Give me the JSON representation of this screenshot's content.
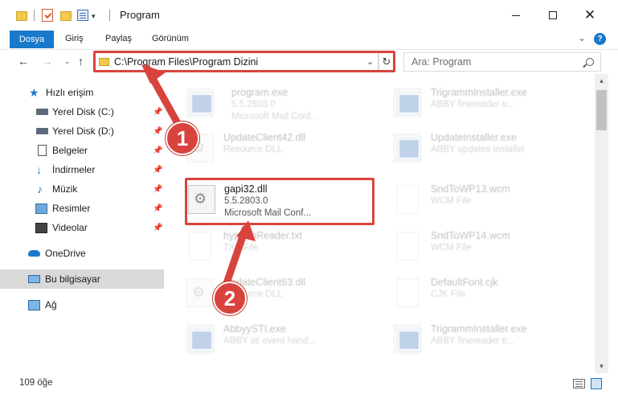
{
  "window": {
    "title": "Program",
    "dropdown_glyph": "▾",
    "minimize_icon": "minimize-icon",
    "maximize_icon": "maximize-icon",
    "close_glyph": "✕"
  },
  "ribbon": {
    "tabs": [
      "Dosya",
      "Giriş",
      "Paylaş",
      "Görünüm"
    ],
    "collapse_glyph": "⌄",
    "help_glyph": "?"
  },
  "nav": {
    "back_glyph": "←",
    "forward_glyph": "→",
    "recent_glyph": "⌄",
    "up_glyph": "↑",
    "address": "C:\\Program Files\\Program Dizini",
    "address_dropdown": "⌄",
    "refresh_glyph": "↻",
    "search_placeholder": "Ara: Program"
  },
  "sidebar": {
    "items": [
      {
        "label": "Hızlı erişim",
        "icon": "star-icon",
        "glyph": "★",
        "pinned": false
      },
      {
        "label": "Yerel Disk (C:)",
        "icon": "disk-icon",
        "pinned": true
      },
      {
        "label": "Yerel Disk (D:)",
        "icon": "disk-icon",
        "pinned": true
      },
      {
        "label": "Belgeler",
        "icon": "documents-icon",
        "pinned": true
      },
      {
        "label": "İndirmeler",
        "icon": "download-icon",
        "glyph": "↓",
        "pinned": true
      },
      {
        "label": "Müzik",
        "icon": "music-icon",
        "glyph": "♪",
        "pinned": true
      },
      {
        "label": "Resimler",
        "icon": "pictures-icon",
        "pinned": true
      },
      {
        "label": "Videolar",
        "icon": "video-icon",
        "pinned": true
      },
      {
        "label": "OneDrive",
        "icon": "cloud-icon",
        "pinned": false
      },
      {
        "label": "Bu bilgisayar",
        "icon": "computer-icon",
        "pinned": false,
        "selected": true
      },
      {
        "label": "Ağ",
        "icon": "network-icon",
        "pinned": false
      }
    ],
    "pin_glyph": "📌"
  },
  "files": [
    {
      "name": "program.exe",
      "line2": "5.5.2803.0",
      "line3": "Microsoft Mail Conf...",
      "icon": "exe-icon",
      "faded": true
    },
    {
      "name": "TrigrammInstaller.exe",
      "line2": "ABBY finereader tr...",
      "line3": "",
      "icon": "exe-icon",
      "faded": true
    },
    {
      "name": "UpdateClient42.dll",
      "line2": "Resource DLL",
      "line3": "",
      "icon": "dll-icon",
      "faded": true
    },
    {
      "name": "UpdateInstaller.exe",
      "line2": "ABBY updates installer",
      "line3": "",
      "icon": "exe-icon",
      "faded": true
    },
    {
      "name": "gapi32.dll",
      "line2": "5.5.2803.0",
      "line3": "Microsoft Mail Conf...",
      "icon": "dll-icon",
      "faded": false
    },
    {
      "name": "SndToWP13.wcm",
      "line2": "WCM File",
      "line3": "",
      "icon": "file-icon",
      "faded": true
    },
    {
      "name": "hyphenReader.txt",
      "line2": "TXT File",
      "line3": "",
      "icon": "file-icon",
      "faded": true
    },
    {
      "name": "SndToWP14.wcm",
      "line2": "WCM File",
      "line3": "",
      "icon": "file-icon",
      "faded": true
    },
    {
      "name": "UpdateClient63.dll",
      "line2": "Resource DLL",
      "line3": "",
      "icon": "dll-icon",
      "faded": true
    },
    {
      "name": "DefaultFont.cjk",
      "line2": "CJK File",
      "line3": "",
      "icon": "file-icon",
      "faded": true
    },
    {
      "name": "AbbyySTI.exe",
      "line2": "ABBY sti event hand...",
      "line3": "",
      "icon": "exe-icon",
      "faded": true
    },
    {
      "name": "TrigrammInstaller.exe",
      "line2": "ABBY finereader tr...",
      "line3": "",
      "icon": "exe-icon",
      "faded": true
    }
  ],
  "status": {
    "count": "109 öğe"
  },
  "scroll": {
    "up_glyph": "▲",
    "down_glyph": "▼"
  },
  "annotations": {
    "step1": "1",
    "step2": "2",
    "color": "#d9433e"
  },
  "colors": {
    "accent": "#1979ca",
    "highlight": "#d9433e",
    "selected_bg": "#d9d9d9"
  }
}
